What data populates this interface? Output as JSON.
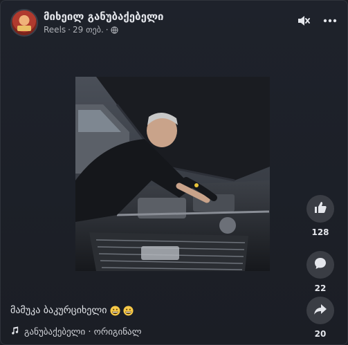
{
  "post": {
    "author": "მიხეილ განუბაქებელი",
    "source": "Reels",
    "separator": "·",
    "time": "29 თებ.",
    "privacy_icon": "globe-icon"
  },
  "controls": {
    "mute_icon": "speaker-muted-icon",
    "more_icon": "more-horizontal-icon"
  },
  "actions": {
    "likes": "128",
    "comments": "22",
    "shares": "20"
  },
  "caption": {
    "text": "მამუკა ბაკურციხელი",
    "emoji_icon": "grinning-face-icon"
  },
  "audio": {
    "label": "განუბაქებელი · ორიგინალ",
    "icon": "music-note-icon"
  },
  "colors": {
    "background": "#1c1f26",
    "button": "#3a3d44",
    "text": "#e4e6eb",
    "secondary_text": "#b0b3b8"
  }
}
